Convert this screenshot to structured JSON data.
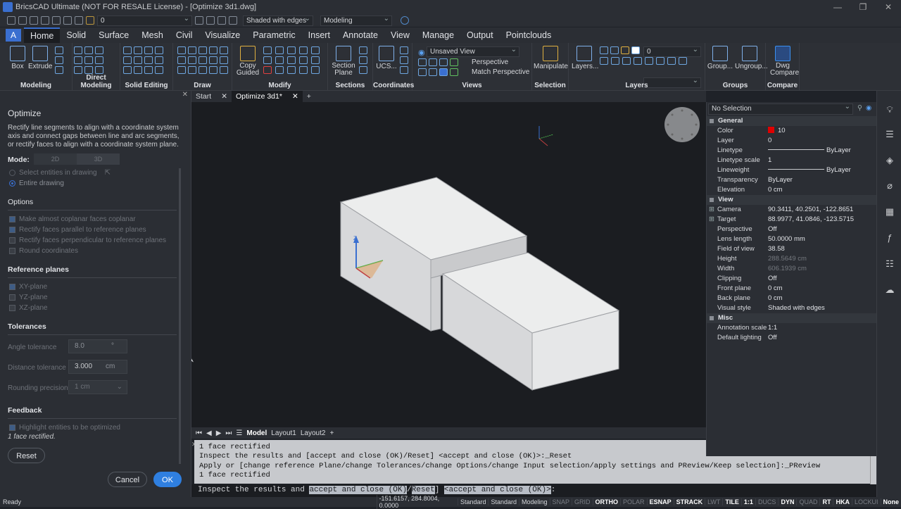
{
  "window": {
    "title": "BricsCAD Ultimate (NOT FOR RESALE License) - [Optimize 3d1.dwg]",
    "min": "—",
    "max": "❐",
    "close": "✕"
  },
  "qat": {
    "layer_value": "0",
    "visual_style": "Shaded with edges",
    "workspace": "Modeling"
  },
  "ribbon_tabs": [
    "Home",
    "Solid",
    "Surface",
    "Mesh",
    "Civil",
    "Visualize",
    "Parametric",
    "Insert",
    "Annotate",
    "View",
    "Manage",
    "Output",
    "Pointclouds"
  ],
  "ribbon": {
    "modeling": {
      "label": "Modeling",
      "box": "Box",
      "extrude": "Extrude"
    },
    "direct_modeling": {
      "label": "Direct Modeling"
    },
    "solid_editing": {
      "label": "Solid Editing"
    },
    "draw": {
      "label": "Draw"
    },
    "modify": {
      "label": "Modify",
      "copy_guided": "Copy\nGuided"
    },
    "sections": {
      "label": "Sections",
      "section_plane": "Section\nPlane"
    },
    "coordinates": {
      "label": "Coordinates",
      "ucs": "UCS..."
    },
    "views": {
      "label": "Views",
      "saved_view": "Unsaved View",
      "perspective": "Perspective",
      "match_perspective": "Match Perspective"
    },
    "selection": {
      "label": "Selection",
      "manipulate": "Manipulate"
    },
    "layers": {
      "label": "Layers",
      "layers_btn": "Layers...",
      "layer_value": "0"
    },
    "groups": {
      "label": "Groups",
      "group": "Group...",
      "ungroup": "Ungroup..."
    },
    "compare": {
      "label": "Compare",
      "dwg_compare": "Dwg\nCompare"
    }
  },
  "panel": {
    "title": "Optimize",
    "description": "Rectify line segments to align with a coordinate system axis and connect gaps between line and arc segments, or rectify faces to align with a coordinate system plane.",
    "mode_label": "Mode:",
    "mode_2d": "2D",
    "mode_3d": "3D",
    "select_entities": "Select entities in drawing",
    "entire_drawing": "Entire drawing",
    "options_title": "Options",
    "options": [
      "Make almost coplanar faces coplanar",
      "Rectify faces parallel to reference planes",
      "Rectify faces perpendicular to reference planes",
      "Round coordinates"
    ],
    "refplanes_title": "Reference planes",
    "refplanes": [
      "XY-plane",
      "YZ-plane",
      "XZ-plane"
    ],
    "tolerances_title": "Tolerances",
    "angle_label": "Angle tolerance",
    "angle_value": "8.0",
    "angle_unit": "°",
    "distance_label": "Distance tolerance",
    "distance_value": "3.000",
    "distance_unit": "cm",
    "rounding_label": "Rounding precision",
    "rounding_value": "1 cm",
    "feedback_title": "Feedback",
    "highlight": "Highlight entities to be optimized",
    "feedback_text": "1 face rectified.",
    "reset": "Reset",
    "cancel": "Cancel",
    "ok": "OK"
  },
  "doc_tabs": {
    "start": "Start",
    "active": "Optimize 3d1*",
    "add": "+"
  },
  "layout_tabs": [
    "Model",
    "Layout1",
    "Layout2"
  ],
  "command_history": [
    "1 face rectified",
    "Inspect the results and [accept and close (OK)/Reset] <accept and close (OK)>:_Reset",
    "Apply or [change reference Plane/change Tolerances/change Options/change Input selection/apply settings and PReview/Keep selection]:_PReview",
    "1 face rectified"
  ],
  "command_line": {
    "pre": "Inspect the results and ",
    "opt_a": "accept and close (OK)",
    "sep": "/",
    "opt_b": "Reset",
    "post": "] ",
    "def": "<accept and close (OK)>",
    "end": ":"
  },
  "properties": {
    "selection": "No Selection",
    "general_title": "General",
    "general": [
      [
        "Color",
        "10"
      ],
      [
        "Layer",
        "0"
      ],
      [
        "Linetype",
        "ByLayer"
      ],
      [
        "Linetype scale",
        "1"
      ],
      [
        "Lineweight",
        "ByLayer"
      ],
      [
        "Transparency",
        "ByLayer"
      ],
      [
        "Elevation",
        "0 cm"
      ]
    ],
    "view_title": "View",
    "view": [
      [
        "Camera",
        "90.3411, 40.2501, -122.8651"
      ],
      [
        "Target",
        "88.9977, 41.0846, -123.5715"
      ],
      [
        "Perspective",
        "Off"
      ],
      [
        "Lens length",
        "50.0000 mm"
      ],
      [
        "Field of view",
        "38.58"
      ],
      [
        "Height",
        "288.5649 cm"
      ],
      [
        "Width",
        "606.1939 cm"
      ],
      [
        "Clipping",
        "Off"
      ],
      [
        "Front plane",
        "0 cm"
      ],
      [
        "Back plane",
        "0 cm"
      ],
      [
        "Visual style",
        "Shaded with edges"
      ]
    ],
    "misc_title": "Misc",
    "misc": [
      [
        "Annotation scale",
        "1:1"
      ],
      [
        "Default lighting",
        "Off"
      ]
    ],
    "color_swatch": "#e00000"
  },
  "status": {
    "ready": "Ready",
    "coords": "-151.6157, 284.8004, 0.0000",
    "items": [
      "Standard",
      "Standard",
      "Modeling",
      "SNAP",
      "GRID",
      "ORTHO",
      "POLAR",
      "ESNAP",
      "STRACK",
      "LWT",
      "TILE",
      "1:1",
      "DUCS",
      "DYN",
      "QUAD",
      "RT",
      "HKA",
      "LOCKUI",
      "None"
    ],
    "on": [
      "ORTHO",
      "ESNAP",
      "STRACK",
      "TILE",
      "1:1",
      "DYN",
      "RT",
      "HKA",
      "None"
    ]
  },
  "colors": {
    "accent": "#2f7fe0",
    "viewport": "#1b1d21",
    "solid": "#e4e5e7"
  }
}
